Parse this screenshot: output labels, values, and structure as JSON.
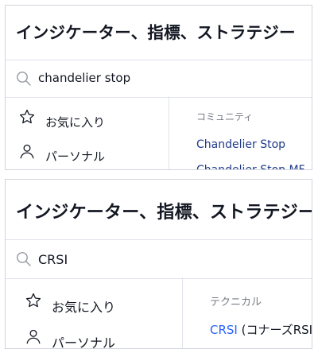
{
  "panel1": {
    "title": "インジケーター、指標、ストラテジー",
    "search": {
      "value": "chandelier stop",
      "icon": "search-icon"
    },
    "sidebar": [
      {
        "label": "お気に入り",
        "icon": "star-icon"
      },
      {
        "label": "パーソナル",
        "icon": "person-icon"
      }
    ],
    "results": {
      "section": "コミュニティ",
      "items": [
        {
          "name": "Chandelier Stop"
        },
        {
          "name": "Chandelier Stop MF"
        }
      ]
    }
  },
  "panel2": {
    "title": "インジケーター、指標、ストラテジー",
    "search": {
      "value": "CRSI",
      "icon": "search-icon"
    },
    "sidebar": [
      {
        "label": "お気に入り",
        "icon": "star-icon"
      },
      {
        "label": "パーソナル",
        "icon": "person-icon"
      }
    ],
    "results": {
      "section": "テクニカル",
      "items": [
        {
          "name": "CRSI",
          "desc": " (コナーズRSI)"
        }
      ]
    }
  },
  "colors": {
    "accent": "#2962ff",
    "text": "#131722",
    "muted": "#787b86",
    "border": "#e0e3eb"
  }
}
